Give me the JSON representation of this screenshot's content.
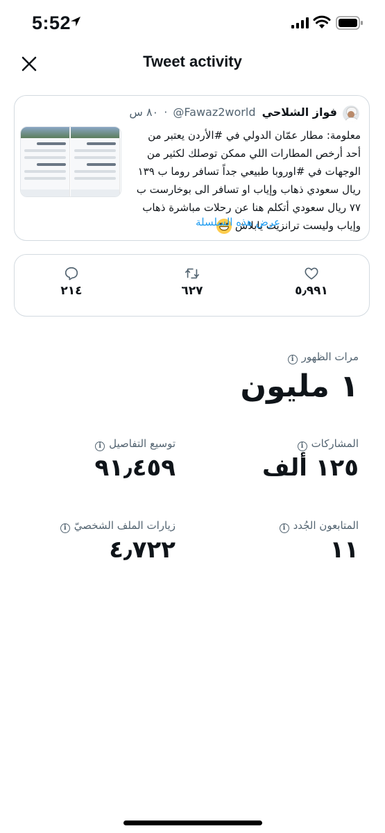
{
  "status_bar": {
    "time": "5:52"
  },
  "nav": {
    "title": "Tweet activity"
  },
  "tweet": {
    "author_name": "فواز الشلاحي",
    "handle": "@Fawaz2world",
    "separator": "·",
    "time": "٨٠ س",
    "text": "معلومة: مطار عمّان الدولي في #الأردن يعتبر من أحد أرخص المطارات اللي ممكن توصلك لكثير من الوجهات في #اوروبا طبيعي جداً تسافر روما ب ١٣٩ ريال سعودي ذهاب وإياب او تسافر الى بوخارست ب ٧٧ ريال سعودي أتكلم هنا عن رحلات مباشرة ذهاب وإياب وليست ترانزيت يابلاش",
    "show_thread": "عرض هذه السلسلة"
  },
  "engagement": {
    "likes": "٥٫٩٩١",
    "retweets": "٦٢٧",
    "replies": "٢١٤"
  },
  "metrics": {
    "impressions": {
      "label": "مرات الظهور",
      "value": "١ مليون"
    },
    "engagements": {
      "label": "المشاركات",
      "value": "١٢٥ ألف"
    },
    "detail_expands": {
      "label": "توسيع التفاصيل",
      "value": "٩١٫٤٥٩"
    },
    "new_followers": {
      "label": "المتابعون الجُدد",
      "value": "١١"
    },
    "profile_visits": {
      "label": "زيارات الملف الشخصيّ",
      "value": "٤٫٧٢٢"
    }
  },
  "icons": {
    "info": "i",
    "close": "close-icon",
    "like": "heart-icon",
    "retweet": "retweet-icon",
    "reply": "reply-icon"
  }
}
